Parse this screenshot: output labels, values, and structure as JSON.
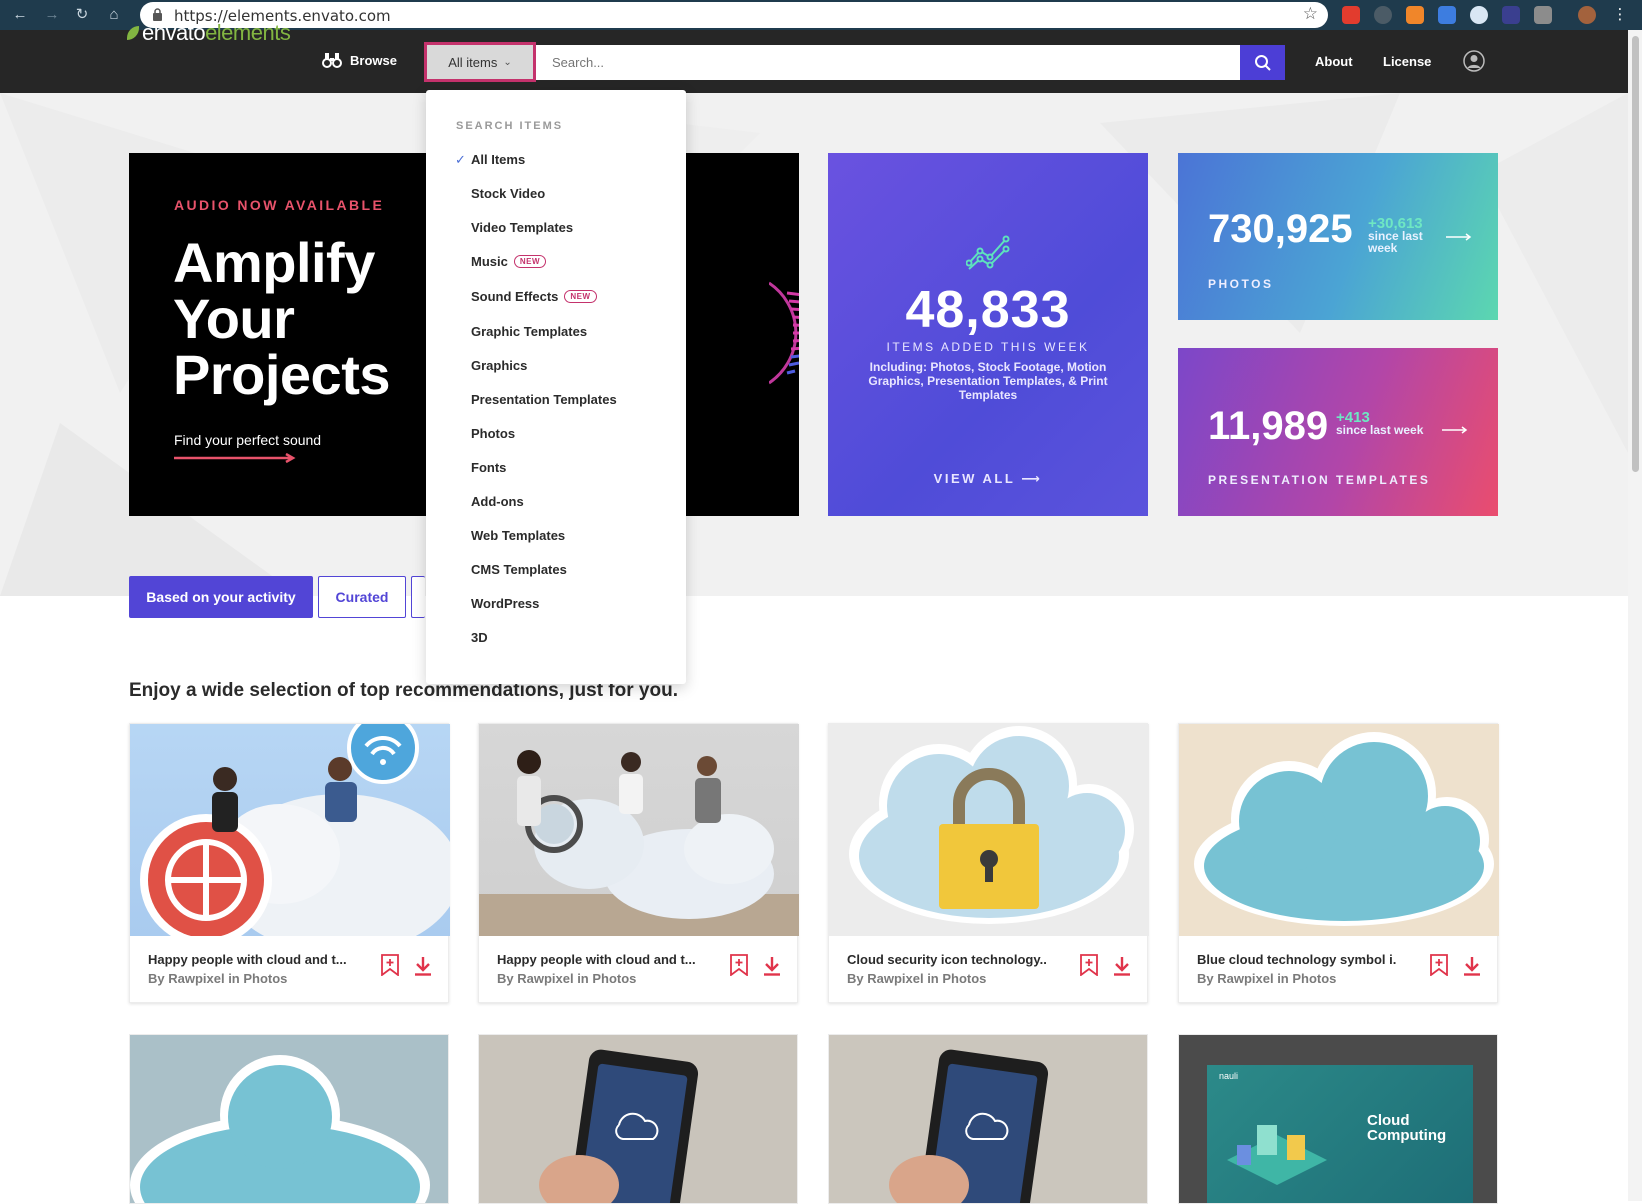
{
  "browser": {
    "url": "https://elements.envato.com"
  },
  "header": {
    "logo_part1": "envato",
    "logo_part2": "elements",
    "browse_label": "Browse",
    "filter_label": "All items",
    "search_placeholder": "Search...",
    "about_label": "About",
    "license_label": "License"
  },
  "dropdown": {
    "heading": "SEARCH ITEMS",
    "items": [
      {
        "label": "All Items",
        "selected": true
      },
      {
        "label": "Stock Video"
      },
      {
        "label": "Video Templates"
      },
      {
        "label": "Music",
        "badge": "NEW"
      },
      {
        "label": "Sound Effects",
        "badge": "NEW"
      },
      {
        "label": "Graphic Templates"
      },
      {
        "label": "Graphics"
      },
      {
        "label": "Presentation Templates"
      },
      {
        "label": "Photos"
      },
      {
        "label": "Fonts"
      },
      {
        "label": "Add-ons"
      },
      {
        "label": "Web Templates"
      },
      {
        "label": "CMS Templates"
      },
      {
        "label": "WordPress"
      },
      {
        "label": "3D"
      }
    ]
  },
  "promo": {
    "kicker": "AUDIO NOW AVAILABLE",
    "headline": "Amplify Your Projects",
    "subtext": "Find your perfect sound"
  },
  "stats": {
    "week": {
      "number": "48,833",
      "label": "ITEMS ADDED THIS WEEK",
      "description": "Including: Photos, Stock Footage, Motion Graphics, Presentation Templates, & Print Templates",
      "cta": "VIEW ALL"
    },
    "photos": {
      "number": "730,925",
      "delta": "+30,613",
      "since": "since last week",
      "label": "PHOTOS"
    },
    "presentations": {
      "number": "11,989",
      "delta": "+413",
      "since": "since last week",
      "label": "PRESENTATION TEMPLATES"
    }
  },
  "tabs": {
    "activity": "Based on your activity",
    "curated": "Curated"
  },
  "section_heading": "Enjoy a wide selection of top recommendations, just for you.",
  "cards": [
    {
      "title": "Happy people with cloud and t...",
      "byline": "By Rawpixel in Photos"
    },
    {
      "title": "Happy people with cloud and t...",
      "byline": "By Rawpixel in Photos"
    },
    {
      "title": "Cloud security icon technology...",
      "byline": "By Rawpixel in Photos"
    },
    {
      "title": "Blue cloud technology symbol i...",
      "byline": "By Rawpixel in Photos"
    }
  ],
  "row2": {
    "nauli_brand": "nauli",
    "nauli_title": "Cloud Computing"
  },
  "colors": {
    "accent": "#5245d6",
    "filter_border": "#c4326c",
    "download_red": "#e0344b",
    "header_bg": "#262626"
  }
}
